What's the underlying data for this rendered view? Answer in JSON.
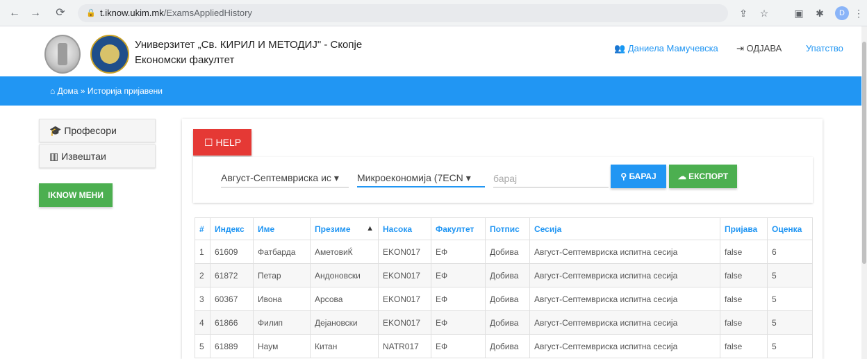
{
  "browser": {
    "url_host": "t.iknow.ukim.mk",
    "url_path": "/ExamsAppliedHistory",
    "profile_initial": "D"
  },
  "header": {
    "university": "Универзитет „Св. КИРИЛ И МЕТОДИЈ\" - Скопје",
    "faculty": "Економски факултет",
    "user_name": "Даниела Мамучевска",
    "logout": "ОДЈАВА",
    "manual": "Упатство"
  },
  "breadcrumb": {
    "home": "Дома",
    "current": "Историја пријавени"
  },
  "sidebar": {
    "items": [
      {
        "label": "Професори",
        "icon": "graduation-cap-icon"
      },
      {
        "label": "Извештаи",
        "icon": "bar-chart-icon"
      }
    ],
    "menu_button": "IKNOW МЕНИ"
  },
  "main": {
    "help_label": "HELP",
    "filters": {
      "session": "Август-Септемвриска ис",
      "subject": "Микроекономија (7ECN",
      "search_placeholder": "барај"
    },
    "search_button": "БАРАЈ",
    "export_button": "ЕКСПОРТ",
    "table": {
      "headers": [
        "#",
        "Индекс",
        "Име",
        "Презиме",
        "Насока",
        "Факултет",
        "Потпис",
        "Сесија",
        "Пријава",
        "Оценка"
      ],
      "rows": [
        [
          "1",
          "61609",
          "Фатбарда",
          "АметовиЌ",
          "EKON017",
          "ЕФ",
          "Добива",
          "Август-Септемвриска испитна сесија",
          "false",
          "6"
        ],
        [
          "2",
          "61872",
          "Петар",
          "Андоновски",
          "EKON017",
          "ЕФ",
          "Добива",
          "Август-Септемвриска испитна сесија",
          "false",
          "5"
        ],
        [
          "3",
          "60367",
          "Ивона",
          "Арсова",
          "EKON017",
          "ЕФ",
          "Добива",
          "Август-Септемвриска испитна сесија",
          "false",
          "5"
        ],
        [
          "4",
          "61866",
          "Филип",
          "Дејановски",
          "EKON017",
          "ЕФ",
          "Добива",
          "Август-Септемвриска испитна сесија",
          "false",
          "5"
        ],
        [
          "5",
          "61889",
          "Наум",
          "Китан",
          "NATR017",
          "ЕФ",
          "Добива",
          "Август-Септемвриска испитна сесија",
          "false",
          "5"
        ]
      ]
    }
  },
  "colors": {
    "primary": "#2196f3",
    "success": "#4caf50",
    "danger": "#e53935"
  }
}
